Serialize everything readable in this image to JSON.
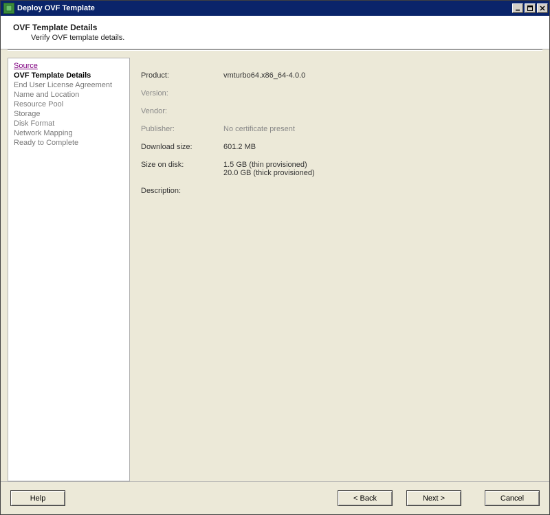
{
  "window": {
    "title": "Deploy OVF Template"
  },
  "header": {
    "title": "OVF Template Details",
    "subtitle": "Verify OVF template details."
  },
  "sidebar": {
    "items": [
      {
        "label": "Source",
        "state": "visited"
      },
      {
        "label": "OVF Template Details",
        "state": "current"
      },
      {
        "label": "End User License Agreement",
        "state": "disabled"
      },
      {
        "label": "Name and Location",
        "state": "disabled"
      },
      {
        "label": "Resource Pool",
        "state": "disabled"
      },
      {
        "label": "Storage",
        "state": "disabled"
      },
      {
        "label": "Disk Format",
        "state": "disabled"
      },
      {
        "label": "Network Mapping",
        "state": "disabled"
      },
      {
        "label": "Ready to Complete",
        "state": "disabled"
      }
    ]
  },
  "details": {
    "product_label": "Product:",
    "product_value": "vmturbo64.x86_64-4.0.0",
    "version_label": "Version:",
    "version_value": "",
    "vendor_label": "Vendor:",
    "vendor_value": "",
    "publisher_label": "Publisher:",
    "publisher_value": "No certificate present",
    "download_size_label": "Download size:",
    "download_size_value": "601.2 MB",
    "size_on_disk_label": "Size on disk:",
    "size_on_disk_thin": "1.5 GB (thin provisioned)",
    "size_on_disk_thick": "20.0 GB (thick provisioned)",
    "description_label": "Description:",
    "description_value": ""
  },
  "footer": {
    "help": "Help",
    "back": "< Back",
    "next": "Next >",
    "cancel": "Cancel"
  }
}
